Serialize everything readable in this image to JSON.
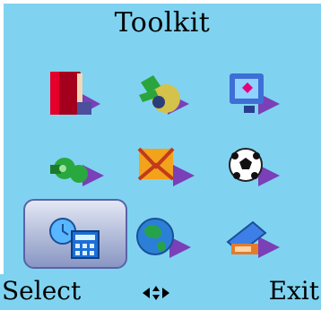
{
  "screen": {
    "title": "Toolkit",
    "background_color": "#7fd3f0",
    "highlight_color": "#8996c3"
  },
  "menu": {
    "selected_index": 6,
    "items": [
      {
        "icon": "stk-book-icon"
      },
      {
        "icon": "stk-plug-icon"
      },
      {
        "icon": "stk-monitor-icon"
      },
      {
        "icon": "stk-gears-icon"
      },
      {
        "icon": "stk-envelope-icon"
      },
      {
        "icon": "stk-soccer-ball-icon"
      },
      {
        "icon": "stk-clock-calculator-icon"
      },
      {
        "icon": "stk-globe-icon"
      },
      {
        "icon": "stk-card-icon"
      }
    ]
  },
  "softkeys": {
    "left_label": "Select",
    "right_label": "Exit",
    "center_icon": "navigation-arrows-icon"
  }
}
